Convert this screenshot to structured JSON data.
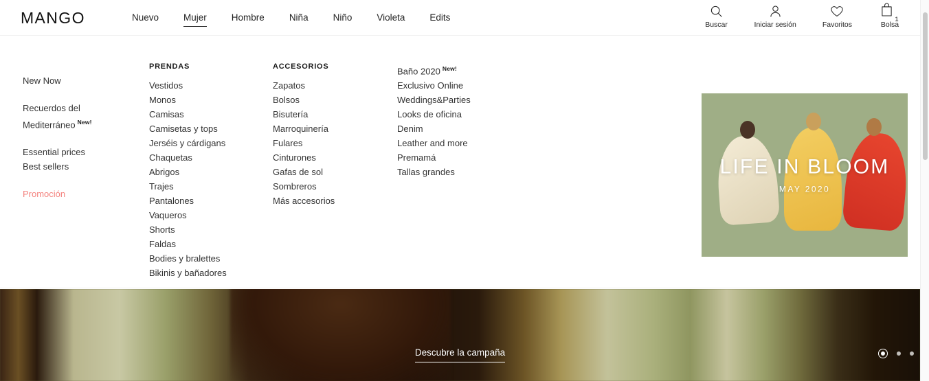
{
  "header": {
    "logo": "MANGO",
    "nav": [
      {
        "label": "Nuevo",
        "active": false
      },
      {
        "label": "Mujer",
        "active": true
      },
      {
        "label": "Hombre",
        "active": false
      },
      {
        "label": "Niña",
        "active": false
      },
      {
        "label": "Niño",
        "active": false
      },
      {
        "label": "Violeta",
        "active": false
      },
      {
        "label": "Edits",
        "active": false
      }
    ],
    "user_nav": [
      {
        "icon": "search-icon",
        "label": "Buscar"
      },
      {
        "icon": "user-icon",
        "label": "Iniciar sesión"
      },
      {
        "icon": "heart-icon",
        "label": "Favoritos"
      },
      {
        "icon": "bag-icon",
        "label": "Bolsa",
        "count": "1"
      }
    ]
  },
  "megamenu": {
    "featured": [
      {
        "items": [
          {
            "label": "New Now",
            "promo": false,
            "badge": ""
          }
        ]
      },
      {
        "items": [
          {
            "label": "Recuerdos del",
            "promo": false,
            "badge": ""
          },
          {
            "label": "Mediterráneo",
            "promo": false,
            "badge": "New!"
          }
        ]
      },
      {
        "items": [
          {
            "label": "Essential prices",
            "promo": false,
            "badge": ""
          },
          {
            "label": "Best sellers",
            "promo": false,
            "badge": ""
          }
        ]
      },
      {
        "items": [
          {
            "label": "Promoción",
            "promo": true,
            "badge": ""
          }
        ]
      }
    ],
    "columns": [
      {
        "heading": "PRENDAS",
        "items": [
          {
            "label": "Vestidos",
            "badge": ""
          },
          {
            "label": "Monos",
            "badge": ""
          },
          {
            "label": "Camisas",
            "badge": ""
          },
          {
            "label": "Camisetas y tops",
            "badge": ""
          },
          {
            "label": "Jerséis y cárdigans",
            "badge": ""
          },
          {
            "label": "Chaquetas",
            "badge": ""
          },
          {
            "label": "Abrigos",
            "badge": ""
          },
          {
            "label": "Trajes",
            "badge": ""
          },
          {
            "label": "Pantalones",
            "badge": ""
          },
          {
            "label": "Vaqueros",
            "badge": ""
          },
          {
            "label": "Shorts",
            "badge": ""
          },
          {
            "label": "Faldas",
            "badge": ""
          },
          {
            "label": "Bodies y bralettes",
            "badge": ""
          },
          {
            "label": "Bikinis y bañadores",
            "badge": ""
          }
        ]
      },
      {
        "heading": "ACCESORIOS",
        "items": [
          {
            "label": "Zapatos",
            "badge": ""
          },
          {
            "label": "Bolsos",
            "badge": ""
          },
          {
            "label": "Bisutería",
            "badge": ""
          },
          {
            "label": "Marroquinería",
            "badge": ""
          },
          {
            "label": "Fulares",
            "badge": ""
          },
          {
            "label": "Cinturones",
            "badge": ""
          },
          {
            "label": "Gafas de sol",
            "badge": ""
          },
          {
            "label": "Sombreros",
            "badge": ""
          },
          {
            "label": "Más accesorios",
            "badge": ""
          }
        ]
      },
      {
        "heading": "",
        "items": [
          {
            "label": "Baño 2020",
            "badge": "New!"
          },
          {
            "label": "Exclusivo Online",
            "badge": ""
          },
          {
            "label": "Weddings&Parties",
            "badge": ""
          },
          {
            "label": "Looks de oficina",
            "badge": ""
          },
          {
            "label": "Denim",
            "badge": ""
          },
          {
            "label": "Leather and more",
            "badge": ""
          },
          {
            "label": "Premamá",
            "badge": ""
          },
          {
            "label": "Tallas grandes",
            "badge": ""
          }
        ]
      }
    ],
    "promo_card": {
      "title": "LIFE IN BLOOM",
      "subtitle": "MAY 2020"
    }
  },
  "hero": {
    "link_label": "Descubre la campaña",
    "slides": 3,
    "active_slide": 1
  },
  "colors": {
    "promo_link": "#f4837f",
    "text": "#222222",
    "divider": "#f0f0f0"
  }
}
